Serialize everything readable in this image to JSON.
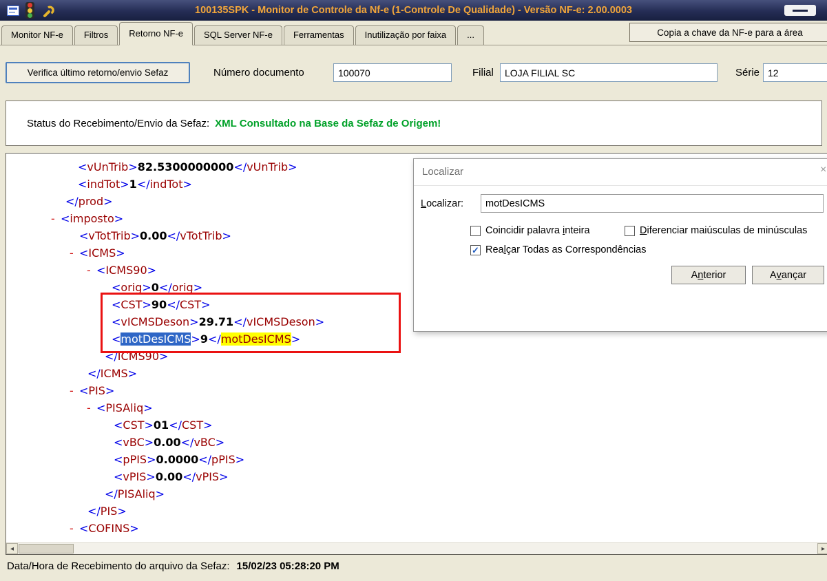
{
  "colors": {
    "titlebar_text": "#f2a63a",
    "xml_punctuation": "#0000e8",
    "xml_tag": "#990000",
    "xml_marker": "#d01414",
    "status_green": "#00a128",
    "selection_blue": "#2e66c6",
    "find_highlight_yellow": "#ffff00",
    "annotation_red": "#ea1212"
  },
  "titlebar": {
    "title": "100135SPK - Monitor de Controle da Nf-e (1-Controle De Qualidade) - Versão NF-e: 2.00.0003",
    "icons": [
      "form-icon",
      "traffic-light-icon",
      "wrench-icon"
    ]
  },
  "tabs": [
    {
      "label": "Monitor NF-e",
      "active": false
    },
    {
      "label": "Filtros",
      "active": false
    },
    {
      "label": "Retorno NF-e",
      "active": true
    },
    {
      "label": "SQL Server NF-e",
      "active": false
    },
    {
      "label": "Ferramentas",
      "active": false
    },
    {
      "label": "Inutilização por faixa",
      "active": false
    },
    {
      "label": "...",
      "active": false
    }
  ],
  "copy_button_label": "Copia a chave da NF-e para a área",
  "toolbar": {
    "verify_button": "Verifica último retorno/envio Sefaz",
    "doc_label": "Número documento",
    "doc_value": "100070",
    "filial_label": "Filial",
    "filial_value": "LOJA FILIAL SC",
    "serie_label": "Série",
    "serie_value": "12"
  },
  "status": {
    "label": "Status do Recebimento/Envio da Sefaz:",
    "value": "XML Consultado na Base da Sefaz de Origem!"
  },
  "xml_lines": [
    {
      "type": "leaf",
      "tag": "vUnTrib",
      "value": "82.5300000000",
      "indent": 104
    },
    {
      "type": "leaf",
      "tag": "indTot",
      "value": "1",
      "indent": 104
    },
    {
      "type": "close",
      "tag": "prod",
      "indent": 86
    },
    {
      "type": "open",
      "tag": "imposto",
      "indent": 79,
      "marker": true
    },
    {
      "type": "leaf",
      "tag": "vTotTrib",
      "value": "0.00",
      "indent": 106
    },
    {
      "type": "open",
      "tag": "ICMS",
      "indent": 106,
      "marker": true
    },
    {
      "type": "open",
      "tag": "ICMS90",
      "indent": 131,
      "marker": true
    },
    {
      "type": "leaf",
      "tag": "orig",
      "value": "0",
      "indent": 153
    },
    {
      "type": "leaf",
      "tag": "CST",
      "value": "90",
      "indent": 153
    },
    {
      "type": "leaf",
      "tag": "vICMSDeson",
      "value": "29.71",
      "indent": 153
    },
    {
      "type": "leaf",
      "tag": "motDesICMS",
      "value": "9",
      "indent": 153,
      "open_hl": "sel",
      "close_hl": "find"
    },
    {
      "type": "close",
      "tag": "ICMS90",
      "indent": 143
    },
    {
      "type": "close",
      "tag": "ICMS",
      "indent": 118
    },
    {
      "type": "open",
      "tag": "PIS",
      "indent": 106,
      "marker": true
    },
    {
      "type": "open",
      "tag": "PISAliq",
      "indent": 131,
      "marker": true
    },
    {
      "type": "leaf",
      "tag": "CST",
      "value": "01",
      "indent": 156
    },
    {
      "type": "leaf",
      "tag": "vBC",
      "value": "0.00",
      "indent": 156
    },
    {
      "type": "leaf",
      "tag": "pPIS",
      "value": "0.0000",
      "indent": 156
    },
    {
      "type": "leaf",
      "tag": "vPIS",
      "value": "0.00",
      "indent": 156
    },
    {
      "type": "close",
      "tag": "PISAliq",
      "indent": 143
    },
    {
      "type": "close",
      "tag": "PIS",
      "indent": 118
    },
    {
      "type": "open",
      "tag": "COFINS",
      "indent": 106,
      "marker": true
    }
  ],
  "find_dialog": {
    "title": "Localizar",
    "field_label": {
      "pre": "",
      "u": "L",
      "post": "ocalizar:"
    },
    "field_value": "motDesICMS",
    "checkboxes": [
      {
        "pre": "Coincidir palavra ",
        "u": "i",
        "post": "nteira",
        "checked": false
      },
      {
        "pre": "",
        "u": "D",
        "post": "iferenciar maiúsculas de minúsculas",
        "checked": false
      },
      {
        "pre": "Rea",
        "u": "l",
        "post": "çar Todas as Correspondências",
        "checked": true
      }
    ],
    "buttons": [
      {
        "pre": "A",
        "u": "n",
        "post": "terior"
      },
      {
        "pre": "A",
        "u": "v",
        "post": "ançar"
      }
    ]
  },
  "footer": {
    "label": "Data/Hora de Recebimento do arquivo da Sefaz:",
    "value": "15/02/23 05:28:20 PM"
  }
}
